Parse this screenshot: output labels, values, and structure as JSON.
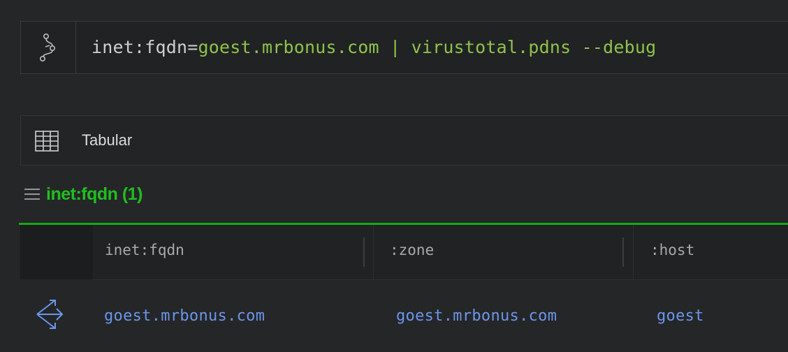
{
  "query": {
    "form": "inet:fqdn",
    "operator": "=",
    "value": "goest.mrbonus.com",
    "pipe": "|",
    "command": "virustotal.pdns --debug",
    "icon": "branch-icon"
  },
  "view": {
    "label": "Tabular",
    "icon": "table-grid-icon"
  },
  "group": {
    "title": "inet:fqdn (1)",
    "icon": "menu-icon"
  },
  "table": {
    "columns": [
      "inet:fqdn",
      ":zone",
      ":host"
    ],
    "rows": [
      {
        "icon": "pivot-icon",
        "cells": [
          "goest.mrbonus.com",
          "goest.mrbonus.com",
          "goest"
        ]
      }
    ]
  },
  "colors": {
    "background": "#252628",
    "accent_green": "#1fbf1f",
    "query_value_green": "#8fc34a",
    "link_blue": "#6b96ea"
  }
}
